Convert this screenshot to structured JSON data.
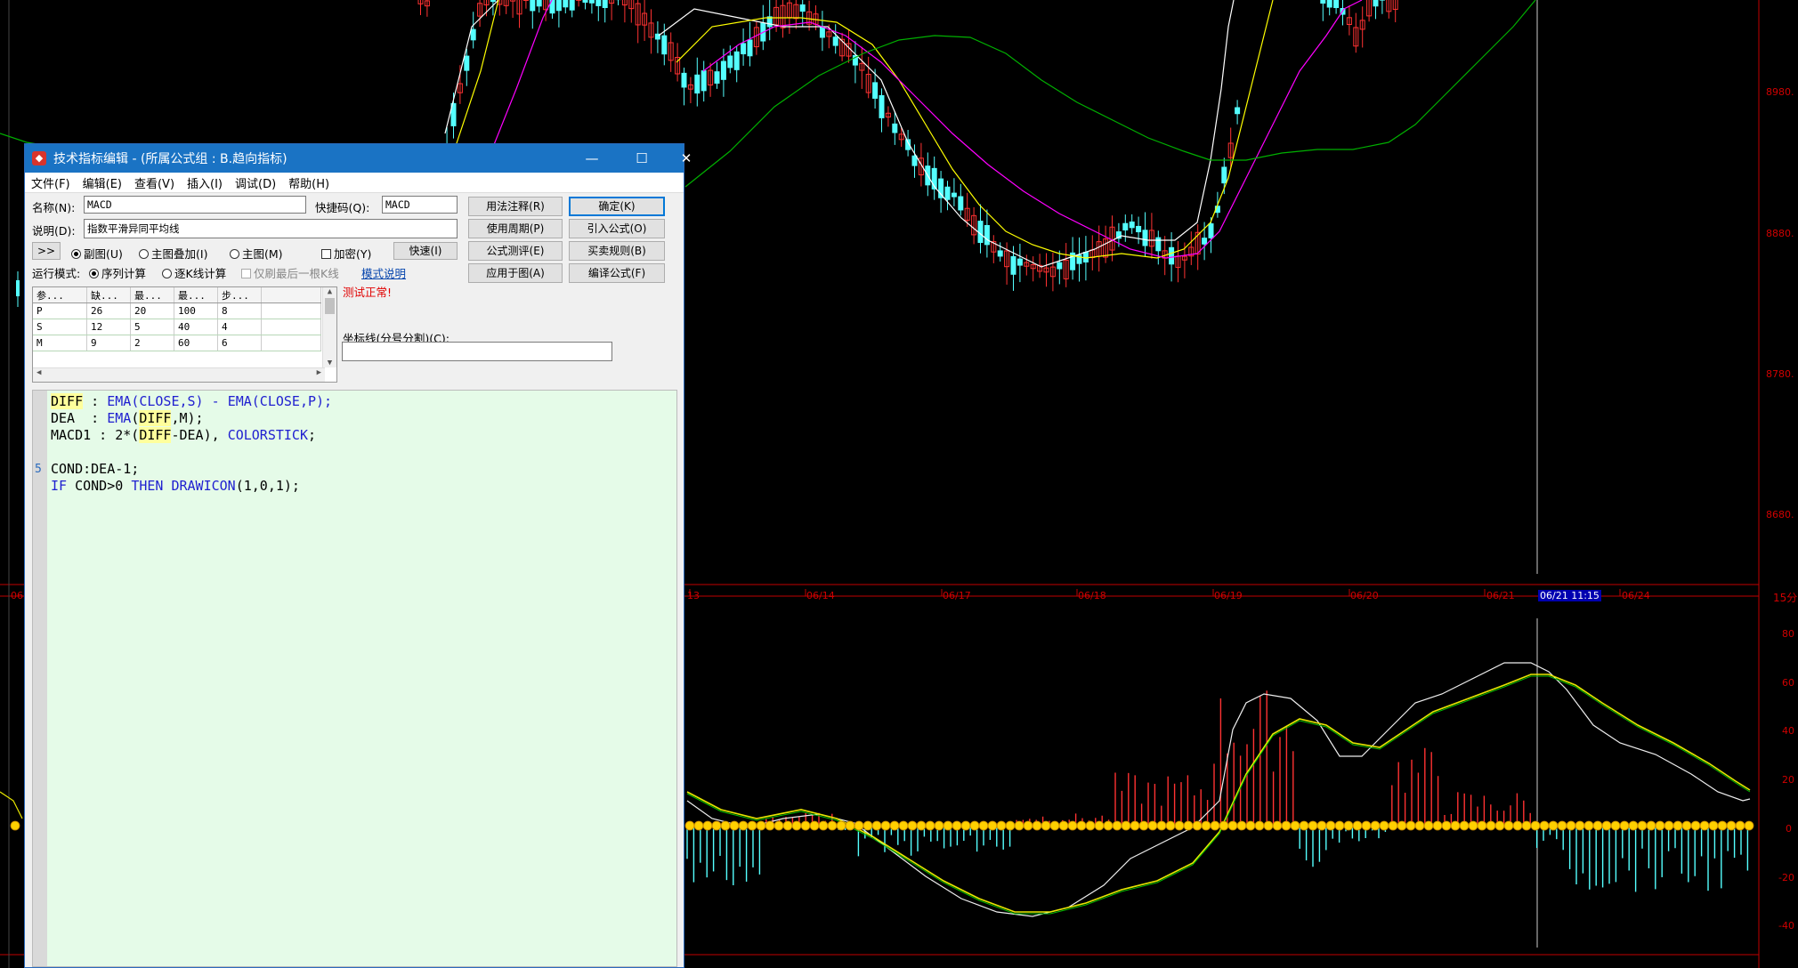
{
  "dialog": {
    "title": "技术指标编辑 - (所属公式组 : B.趋向指标)",
    "window_buttons": {
      "minimize": "—",
      "maximize": "☐",
      "close": "✕"
    },
    "menu": [
      "文件(F)",
      "编辑(E)",
      "查看(V)",
      "插入(I)",
      "调试(D)",
      "帮助(H)"
    ],
    "name_label": "名称(N):",
    "name_value": "MACD",
    "shortcut_label": "快捷码(Q):",
    "shortcut_value": "MACD",
    "desc_label": "说明(D):",
    "desc_value": "指数平滑异同平均线",
    "expand_button": ">>",
    "chart_options": {
      "sub": "副图(U)",
      "overlay": "主图叠加(I)",
      "main": "主图(M)"
    },
    "encrypt_label": "加密(Y)",
    "fast_button": "快速(I)",
    "run_mode_label": "运行模式:",
    "run_modes": {
      "sequence": "序列计算",
      "per_bar": "逐K线计算"
    },
    "last_bar_label": "仅刷最后一根K线",
    "mode_help_link": "模式说明",
    "status_text": "测试正常!",
    "buttons": {
      "usage": "用法注释(R)",
      "period": "使用周期(P)",
      "test": "公式测评(E)",
      "apply": "应用于图(A)",
      "ok": "确定(K)",
      "import": "引入公式(O)",
      "rules": "买卖规则(B)",
      "compile": "编译公式(F)"
    },
    "params": {
      "headers": [
        "参...",
        "缺...",
        "最...",
        "最...",
        "步..."
      ],
      "rows": [
        [
          "P",
          "26",
          "20",
          "100",
          "8"
        ],
        [
          "S",
          "12",
          "5",
          "40",
          "4"
        ],
        [
          "M",
          "9",
          "2",
          "60",
          "6"
        ]
      ]
    },
    "axis_line_label": "坐标线(分号分割)(C):",
    "axis_line_value": "",
    "code": {
      "line1_a": "DIFF",
      "line1_b": " : ",
      "line1_c": "EMA",
      "line1_d": "(CLOSE,S) - ",
      "line1_e": "EMA",
      "line1_f": "(CLOSE,P);",
      "line2_a": "DEA  : ",
      "line2_b": "EMA",
      "line2_c": "(",
      "line2_d": "DIFF",
      "line2_e": ",M);",
      "line3_a": "MACD1 : 2*(",
      "line3_b": "DIFF",
      "line3_c": "-DEA), ",
      "line3_d": "COLORSTICK",
      "line3_e": ";",
      "line5_num": "5",
      "line5": "COND:DEA-1;",
      "line6_a": "IF",
      "line6_b": " COND>0 ",
      "line6_c": "THEN",
      "line6_d": " ",
      "line6_e": "DRAWICON",
      "line6_f": "(1,0,1);"
    }
  },
  "chart": {
    "price_axis_labels": [
      "8980.",
      "8880.",
      "8780.",
      "8680."
    ],
    "macd_axis_labels": [
      "80",
      "60",
      "40",
      "20",
      "0",
      "-20",
      "-40"
    ],
    "date_labels": [
      "06",
      "13",
      "06/14",
      "06/17",
      "06/18",
      "06/19",
      "06/20",
      "06/21",
      "06/21 11:15",
      "06/24"
    ],
    "period_label": "15分",
    "colors": {
      "up": "#ff3232",
      "down": "#54ffff",
      "ma_white": "#ffffff",
      "ma_yellow": "#ffff00",
      "ma_magenta": "#ff00ff",
      "ma_green": "#00b000",
      "axis_red": "#c00000",
      "dea_yellow": "#e8e800",
      "dea_green": "#00c000",
      "icon": "#ffd000"
    }
  }
}
